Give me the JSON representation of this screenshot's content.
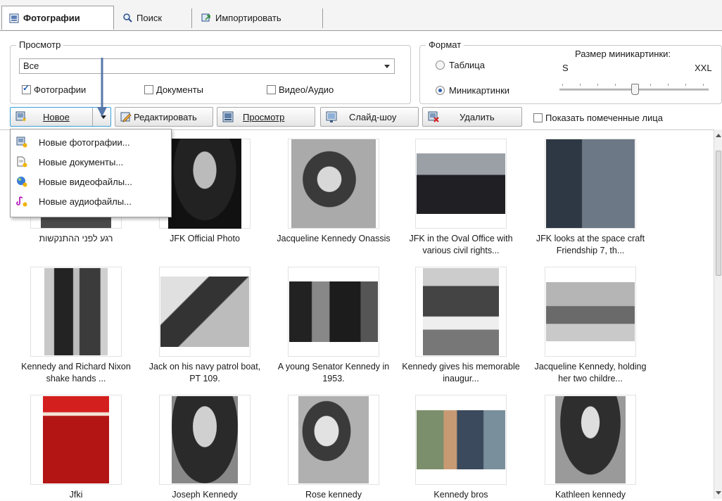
{
  "tabs": [
    {
      "label": "Фотографии",
      "icon": "photos-tab-icon",
      "active": true
    },
    {
      "label": "Поиск",
      "icon": "magnifier-icon",
      "active": false
    },
    {
      "label": "Импортировать",
      "icon": "import-icon",
      "active": false
    }
  ],
  "view": {
    "legend": "Просмотр",
    "select_value": "Все",
    "checkboxes": [
      {
        "label": "Фотографии",
        "checked": true
      },
      {
        "label": "Документы",
        "checked": false
      },
      {
        "label": "Видео/Аудио",
        "checked": false
      }
    ]
  },
  "format": {
    "legend": "Формат",
    "radios": [
      {
        "label": "Таблица",
        "selected": false
      },
      {
        "label": "Миникартинки",
        "selected": true
      }
    ],
    "thumb_size_label": "Размер миникартинки:",
    "min_label": "S",
    "max_label": "XXL",
    "thumb_size_level": 0.5
  },
  "toolbar": {
    "new_label": "Новое",
    "edit_label": "Редактировать",
    "view_label": "Просмотр",
    "slideshow_label": "Слайд-шоу",
    "delete_label": "Удалить",
    "show_faces_label": "Показать помеченные лица"
  },
  "new_menu": [
    {
      "label": "Новые фотографии...",
      "icon": "new-photo-icon"
    },
    {
      "label": "Новые документы...",
      "icon": "new-document-icon"
    },
    {
      "label": "Новые видеофайлы...",
      "icon": "new-video-icon"
    },
    {
      "label": "Новые аудиофайлы...",
      "icon": "new-audio-icon"
    }
  ],
  "photos": [
    {
      "caption": "רגע לפני ההתנקשות"
    },
    {
      "caption": "JFK Official Photo"
    },
    {
      "caption": "Jacqueline Kennedy Onassis"
    },
    {
      "caption": "JFK in the Oval Office with various civil rights..."
    },
    {
      "caption": "JFK looks at the space craft Friendship 7, th..."
    },
    {
      "caption": "Kennedy and Richard Nixon shake hands ..."
    },
    {
      "caption": "Jack on his navy patrol boat, PT 109."
    },
    {
      "caption": "A young Senator Kennedy in 1953."
    },
    {
      "caption": "Kennedy gives his memorable inaugur..."
    },
    {
      "caption": "Jacqueline Kennedy, holding her two childre..."
    },
    {
      "caption": "Jfki"
    },
    {
      "caption": "Joseph Kennedy"
    },
    {
      "caption": "Rose kennedy"
    },
    {
      "caption": "Kennedy bros"
    },
    {
      "caption": "Kathleen kennedy"
    }
  ]
}
